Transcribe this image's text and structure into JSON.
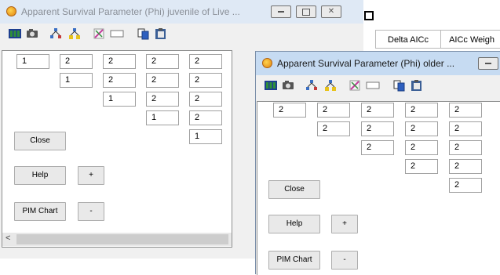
{
  "background_grid": {
    "headers": [
      "Delta AICc",
      "AICc Weigh"
    ]
  },
  "window_back": {
    "title": "Apparent Survival Parameter (Phi) juvenile of Live ...",
    "toolbar_icons": [
      "table-icon",
      "camera-icon",
      "flowchart-icon",
      "flowchart-yellow-icon",
      "brush-icon",
      "rectangle-icon",
      "copy-icon",
      "paste-icon"
    ],
    "matrix": [
      [
        "1",
        "2",
        "2",
        "2",
        "2"
      ],
      [
        "1",
        "2",
        "2",
        "2"
      ],
      [
        "1",
        "2",
        "2"
      ],
      [
        "1",
        "2"
      ],
      [
        "1"
      ]
    ],
    "buttons": {
      "close": "Close",
      "help": "Help",
      "plus": "+",
      "pim_chart": "PIM Chart",
      "minus": "-"
    },
    "scroll_left": "<"
  },
  "window_front": {
    "title": "Apparent Survival Parameter (Phi) older ...",
    "toolbar_icons": [
      "table-icon",
      "camera-icon",
      "flowchart-icon",
      "flowchart-yellow-icon",
      "brush-icon",
      "rectangle-icon",
      "copy-icon",
      "paste-icon"
    ],
    "matrix": [
      [
        "2",
        "2",
        "2",
        "2",
        "2"
      ],
      [
        "2",
        "2",
        "2",
        "2"
      ],
      [
        "2",
        "2",
        "2"
      ],
      [
        "2",
        "2"
      ],
      [
        "2"
      ]
    ],
    "buttons": {
      "close": "Close",
      "help": "Help",
      "plus": "+",
      "pim_chart": "PIM Chart",
      "minus": "-"
    }
  },
  "colors": {
    "titlebar": "#c6dbf2",
    "window_bg": "#f0f0f0",
    "cell_border": "#a0a0a0"
  }
}
